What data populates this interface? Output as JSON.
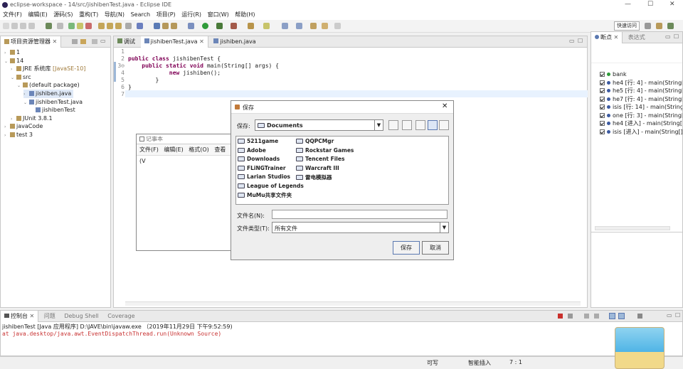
{
  "window": {
    "title": "eclipse-workspace - 14/src/jishibenTest.java - Eclipse IDE"
  },
  "menu": [
    "文件(F)",
    "编辑(E)",
    "源码(S)",
    "重构(T)",
    "导航(N)",
    "Search",
    "项目(P)",
    "运行(R)",
    "窗口(W)",
    "帮助(H)"
  ],
  "toolbar": {
    "quick_access": "快速访问"
  },
  "project_explorer": {
    "tab_label": "项目资源管理器",
    "tree": [
      {
        "label": "1",
        "indent": 0,
        "twisty": "›"
      },
      {
        "label": "14",
        "indent": 0,
        "twisty": "⌄"
      },
      {
        "label": "JRE 系统库",
        "suffix": " [JavaSE-10]",
        "indent": 1,
        "twisty": "›"
      },
      {
        "label": "src",
        "indent": 1,
        "twisty": "⌄"
      },
      {
        "label": "(default package)",
        "indent": 2,
        "twisty": "⌄"
      },
      {
        "label": "jishiben.java",
        "indent": 3,
        "twisty": "›",
        "selected": true
      },
      {
        "label": "jishibenTest.java",
        "indent": 3,
        "twisty": "⌄"
      },
      {
        "label": "jishibenTest",
        "indent": 4,
        "twisty": ""
      },
      {
        "label": "JUnit 3.8.1",
        "indent": 1,
        "twisty": "›"
      },
      {
        "label": "javaCode",
        "indent": 0,
        "twisty": "›"
      },
      {
        "label": "test 3",
        "indent": 0,
        "twisty": "›"
      }
    ]
  },
  "editor": {
    "tabs": [
      "调试",
      "jishibenTest.java",
      "jishiben.java"
    ],
    "line_numbers": [
      "1",
      "2",
      "3⊖",
      "4",
      "5",
      "6",
      "7"
    ],
    "code": [
      "",
      "public class jishibenTest {",
      "    public static void main(String[] args) {",
      "            new jishiben();",
      "        }",
      "}",
      ""
    ]
  },
  "notepad": {
    "title": "记事本",
    "menu": [
      "文件(F)",
      "编辑(E)",
      "格式(O)",
      "查看(V"
    ]
  },
  "save_dialog": {
    "title": "保存",
    "save_in_label": "保存:",
    "save_in_value": "Documents",
    "files_col1": [
      "5211game",
      "Adobe",
      "Downloads",
      "FLiNGTrainer",
      "Larian Studios",
      "League of Legends",
      "MuMu共享文件夹"
    ],
    "files_col2": [
      "QQPCMgr",
      "Rockstar Games",
      "Tencent Files",
      "Warcraft III",
      "雷电模拟器"
    ],
    "filename_label": "文件名(N):",
    "filename_value": "",
    "filetype_label": "文件类型(T):",
    "filetype_value": "所有文件",
    "save_button": "保存",
    "cancel_button": "取消"
  },
  "breakpoints": {
    "tabs": [
      "断点",
      "表达式"
    ],
    "items": [
      "bank",
      "he4 [行: 4] - main(String[",
      "he5 [行: 4] - main(String[",
      "he7 [行: 4] - main(String[",
      "isis [行: 14] - main(String",
      "one [行: 3] - main(String[",
      "he4 [进入] - main(String[])",
      "isis [进入] - main(String[])"
    ]
  },
  "console": {
    "tabs": [
      "控制台",
      "问题",
      "Debug Shell",
      "Coverage"
    ],
    "launch_line": "jishibenTest [Java 应用程序] D:\\JAVE\\bin\\javaw.exe （2019年11月29日 下午9:52:59)",
    "output_line": "        at java.desktop/java.awt.EventDispatchThread.run(Unknown Source)"
  },
  "statusbar": {
    "writable": "可写",
    "insert_mode": "智能插入",
    "position": "7 : 1"
  },
  "colors": {
    "keyword": "#7f0055",
    "error_text": "#c83232",
    "accent": "#3c78d8"
  }
}
